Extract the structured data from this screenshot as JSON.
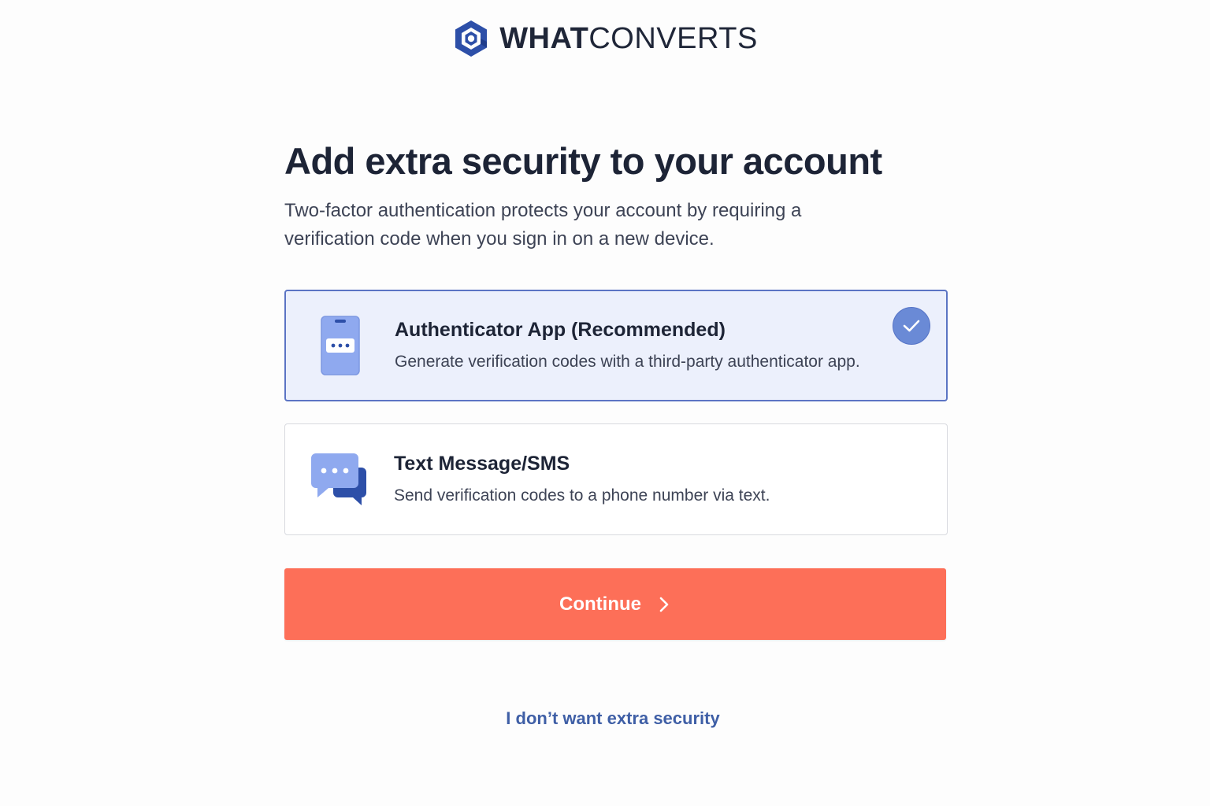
{
  "header": {
    "logo_bold": "WHAT",
    "logo_light": "CONVERTS",
    "logo_icon": "whatconverts-logo-icon",
    "brand_color": "#2d4fa8"
  },
  "main": {
    "title": "Add extra security to your account",
    "subtitle": "Two-factor authentication protects your account by requiring a verification code when you sign in on a new device."
  },
  "options": [
    {
      "title": "Authenticator App (Recommended)",
      "description": "Generate verification codes with a third-party authenticator app.",
      "icon": "phone-icon",
      "selected": true
    },
    {
      "title": "Text Message/SMS",
      "description": "Send verification codes to a phone number via text.",
      "icon": "chat-bubbles-icon",
      "selected": false
    }
  ],
  "actions": {
    "continue_label": "Continue",
    "continue_color": "#fd6f58",
    "skip_label": "I don’t want extra security"
  },
  "colors": {
    "selected_border": "#5b74c4",
    "selected_background": "#ecf0fc",
    "check_badge": "#6a8ad6",
    "link": "#3f5fa6"
  }
}
